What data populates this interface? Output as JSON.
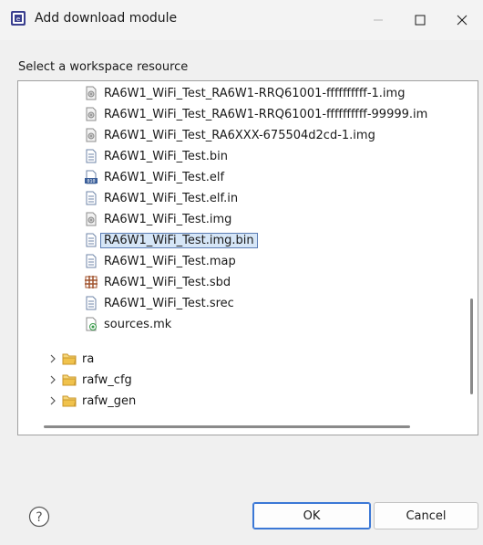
{
  "window": {
    "title": "Add download module",
    "minimize_icon": "minimize-icon",
    "maximize_icon": "maximize-icon",
    "close_icon": "close-icon"
  },
  "instruction": "Select a workspace resource",
  "tree": {
    "files": [
      {
        "label": "RA6W1_WiFi_Test_RA6W1-RRQ61001-ffffffffff-1.img",
        "icon": "img-file-icon"
      },
      {
        "label": "RA6W1_WiFi_Test_RA6W1-RRQ61001-ffffffffff-99999.im",
        "icon": "img-file-icon"
      },
      {
        "label": "RA6W1_WiFi_Test_RA6XXX-675504d2cd-1.img",
        "icon": "img-file-icon"
      },
      {
        "label": "RA6W1_WiFi_Test.bin",
        "icon": "text-file-icon"
      },
      {
        "label": "RA6W1_WiFi_Test.elf",
        "icon": "binary-file-icon"
      },
      {
        "label": "RA6W1_WiFi_Test.elf.in",
        "icon": "text-file-icon"
      },
      {
        "label": "RA6W1_WiFi_Test.img",
        "icon": "img-file-icon"
      },
      {
        "label": "RA6W1_WiFi_Test.img.bin",
        "icon": "text-file-icon",
        "selected": true
      },
      {
        "label": "RA6W1_WiFi_Test.map",
        "icon": "text-file-icon"
      },
      {
        "label": "RA6W1_WiFi_Test.sbd",
        "icon": "grid-file-icon"
      },
      {
        "label": "RA6W1_WiFi_Test.srec",
        "icon": "text-file-icon"
      },
      {
        "label": "sources.mk",
        "icon": "makefile-icon"
      }
    ],
    "folders": [
      {
        "label": "ra",
        "icon": "folder-icon"
      },
      {
        "label": "rafw_cfg",
        "icon": "folder-icon"
      },
      {
        "label": "rafw_gen",
        "icon": "folder-icon"
      }
    ]
  },
  "buttons": {
    "help_icon": "help-icon",
    "ok": "OK",
    "cancel": "Cancel"
  },
  "colors": {
    "selection_bg": "#d6e6f7",
    "selection_border": "#5b7db5",
    "default_button_border": "#3b78d6",
    "folder_yellow": "#e8b53a"
  }
}
